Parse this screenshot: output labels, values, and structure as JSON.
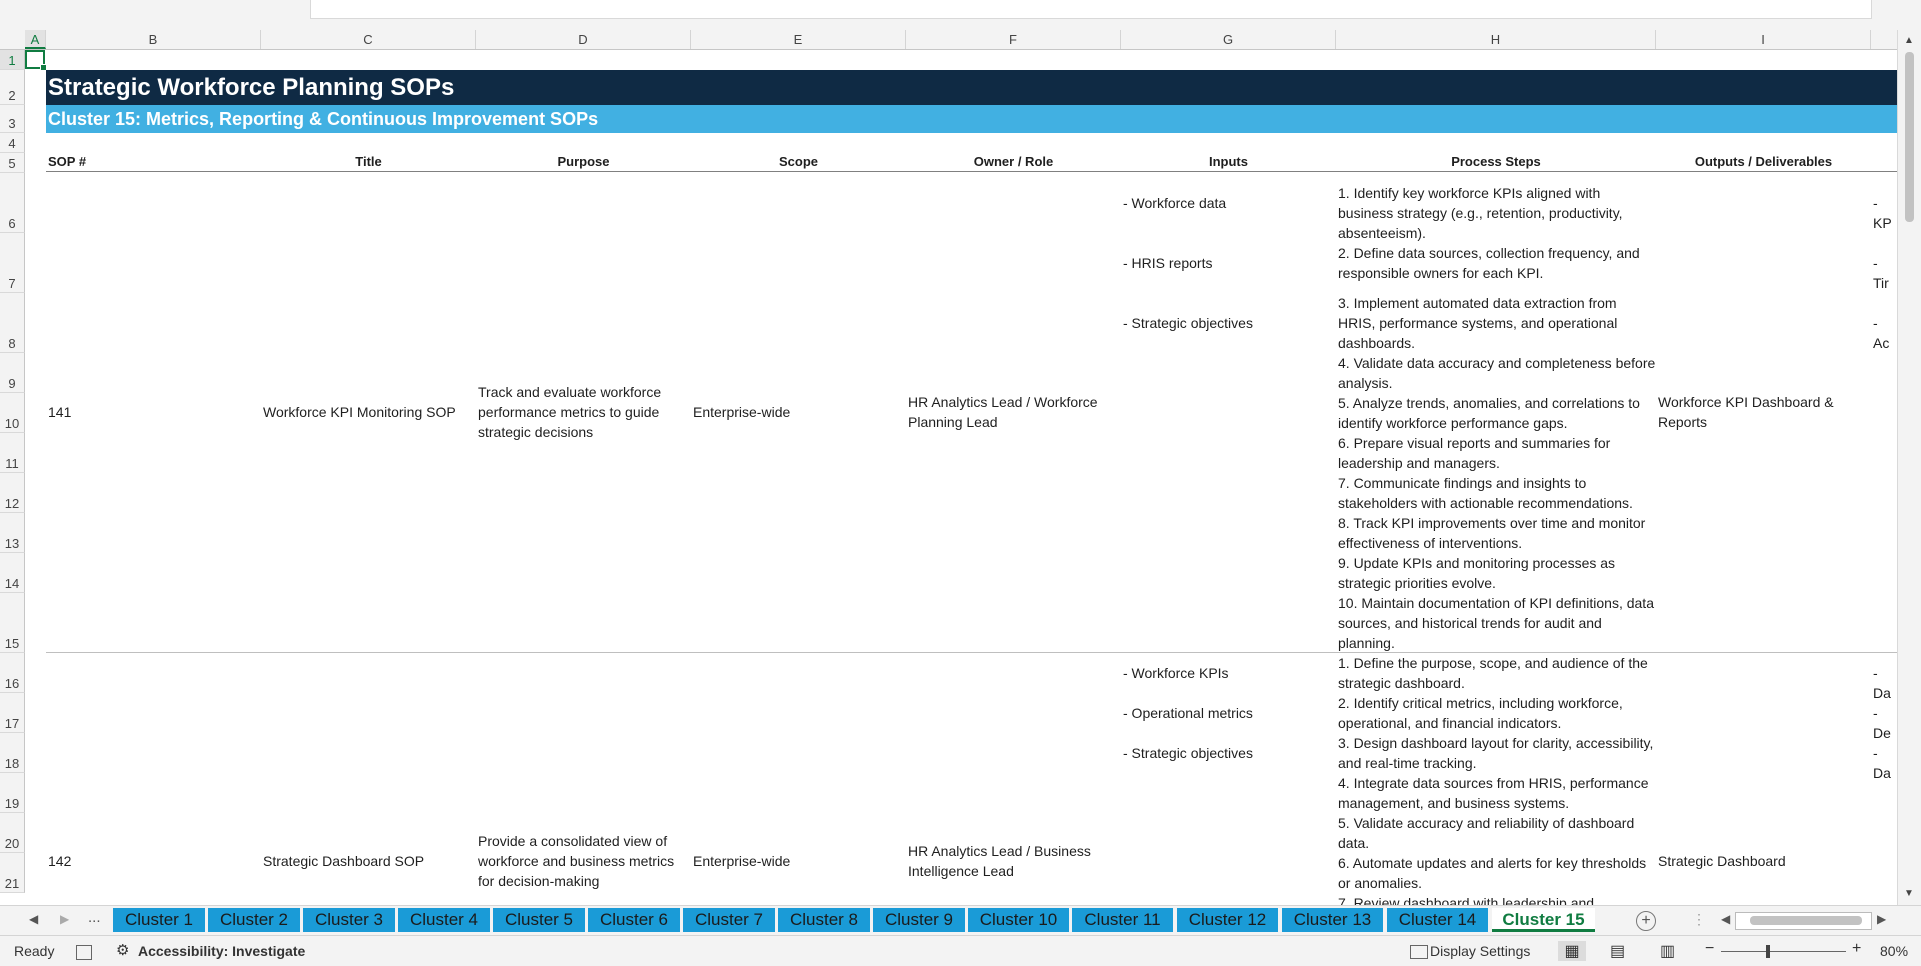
{
  "columns": [
    "A",
    "B",
    "C",
    "D",
    "E",
    "F",
    "G",
    "H",
    "I"
  ],
  "rows": [
    "1",
    "2",
    "3",
    "4",
    "5",
    "6",
    "7",
    "8",
    "9",
    "10",
    "11",
    "12",
    "13",
    "14",
    "15",
    "16",
    "17",
    "18",
    "19",
    "20",
    "21"
  ],
  "sheet": {
    "title": "Strategic Workforce Planning SOPs",
    "subtitle": "Cluster 15: Metrics, Reporting & Continuous Improvement SOPs",
    "headers": {
      "sop": "SOP #",
      "title": "Title",
      "purpose": "Purpose",
      "scope": "Scope",
      "owner": "Owner / Role",
      "inputs": "Inputs",
      "steps": "Process Steps",
      "outputs": "Outputs / Deliverables"
    },
    "sop141": {
      "number": "141",
      "title": "Workforce KPI Monitoring SOP",
      "purpose": "Track and evaluate workforce performance metrics to guide strategic decisions",
      "scope": "Enterprise-wide",
      "owner": "HR Analytics Lead / Workforce Planning Lead",
      "inputs": [
        "- Workforce data",
        "- HRIS reports",
        "- Strategic objectives"
      ],
      "steps": [
        "1. Identify key workforce KPIs aligned with business strategy (e.g., retention, productivity, absenteeism).",
        "2. Define data sources, collection frequency, and responsible owners for each KPI.",
        "3. Implement automated data extraction from HRIS, performance systems, and operational dashboards.",
        "4. Validate data accuracy and completeness before analysis.",
        "5. Analyze trends, anomalies, and correlations to identify workforce performance gaps.",
        "6. Prepare visual reports and summaries for leadership and managers.",
        "7. Communicate findings and insights to stakeholders with actionable recommendations.",
        "8. Track KPI improvements over time and monitor effectiveness of interventions.",
        "9. Update KPIs and monitoring processes as strategic priorities evolve.",
        "10. Maintain documentation of KPI definitions, data sources, and historical trends for audit and planning."
      ],
      "outputs": "Workforce KPI Dashboard & Reports",
      "overflow": [
        "- KP",
        "- Tir",
        "- Ac"
      ]
    },
    "sop142": {
      "number": "142",
      "title": "Strategic Dashboard SOP",
      "purpose": "Provide a consolidated view of workforce and business metrics for decision-making",
      "scope": "Enterprise-wide",
      "owner": "HR Analytics Lead / Business Intelligence Lead",
      "inputs": [
        "- Workforce KPIs",
        "- Operational metrics",
        "- Strategic objectives"
      ],
      "steps": [
        "1. Define the purpose, scope, and audience of the strategic dashboard.",
        "2. Identify critical metrics, including workforce, operational, and financial indicators.",
        "3. Design dashboard layout for clarity, accessibility, and real-time tracking.",
        "4. Integrate data sources from HRIS, performance management, and business systems.",
        "5. Validate accuracy and reliability of dashboard data.",
        "6. Automate updates and alerts for key thresholds or anomalies.",
        "7. Review dashboard with leadership and"
      ],
      "outputs": "Strategic Dashboard",
      "overflow": [
        "- Da",
        "- De",
        "- Da"
      ]
    }
  },
  "tabs": {
    "more": "...",
    "items": [
      "Cluster 1",
      "Cluster 2",
      "Cluster 3",
      "Cluster 4",
      "Cluster 5",
      "Cluster 6",
      "Cluster 7",
      "Cluster 8",
      "Cluster 9",
      "Cluster 10",
      "Cluster 11",
      "Cluster 12",
      "Cluster 13",
      "Cluster 14",
      "Cluster 15"
    ],
    "active": "Cluster 15"
  },
  "status": {
    "ready": "Ready",
    "accessibility": "Accessibility: Investigate",
    "display_settings": "Display Settings",
    "zoom": "80%"
  },
  "colors": {
    "title_band": "#0f2a44",
    "subtitle_band": "#41b0e2",
    "tab": "#1a9bd7",
    "accent": "#107c41"
  }
}
